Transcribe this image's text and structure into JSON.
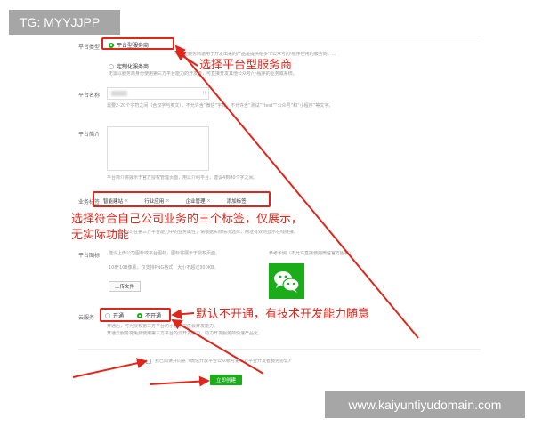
{
  "watermarks": {
    "top_left": "TG: MYYJJPP",
    "bottom_right": "www.kaiyuntiyudomain.com"
  },
  "form": {
    "platform_type": {
      "label": "平台类型",
      "options": [
        {
          "label": "平台型服务商",
          "selected": true
        },
        {
          "label": "定制化服务商",
          "selected": false
        }
      ],
      "hint_top": "平台型服务商适用于开发出来的产品是提供给多个公众号/小程序使用的服务商，...",
      "hint": "无需以服务商身份使用第三方平台能力的开发者，可直接开发其他公众号/小程序的业务或系统。"
    },
    "platform_name": {
      "label": "平台名称",
      "count": "0",
      "hint": "需要2-20个字符之间（含汉字与英文），不允许含“微信”字样，不允许含“测试”“test”“公众号”和“小程序”等文字。"
    },
    "platform_intro": {
      "label": "平台简介",
      "hint": "平台简介将展示于官方授权管理页面，用以介绍平台，建议4到80个字之间。"
    },
    "business_tags": {
      "label": "业务标签",
      "tags": [
        "智能建站",
        "行业应用",
        "企业管理",
        "添加标签"
      ],
      "hint": "用于标识公司在第三方平台能力中的业务属性，请根据实际情况选择，网址有效则显示在线链接。"
    },
    "platform_icon": {
      "label": "平台图标",
      "hint": "建议上传公司图标或平台图标，图标将展示于授权页面。",
      "spec": "108*108像素，仅支持PNG格式，大小不超过300KB。",
      "upload_label": "上传文件",
      "example_label": "参考示例（不允许直接使用微信官方图标）"
    },
    "cloud_service": {
      "label": "云服务",
      "options": [
        {
          "label": "开通",
          "selected": false
        },
        {
          "label": "不开通",
          "selected": true
        }
      ],
      "hint": "开通云服务将免费使用第三方平台的云开发能力，助力开发服务商快速产品化。",
      "hint2": "开通后，可为授权第三方平台的小程序提供云开发能力。"
    },
    "agreement": {
      "text": "我已阅读并同意《微信开放平台公众帐号第三方平台开发者服务协议》"
    },
    "submit_label": "立即创建"
  },
  "annotations": {
    "platform_type": "选择平台型服务商",
    "tags_line1": "选择符合自己公司业务的三个标签，仅展示，",
    "tags_line2": "无实际功能",
    "cloud": "默认不开通，有技术开发能力随意"
  },
  "colors": {
    "annotation_red": "#e0261b",
    "wechat_green": "#1aad19"
  }
}
